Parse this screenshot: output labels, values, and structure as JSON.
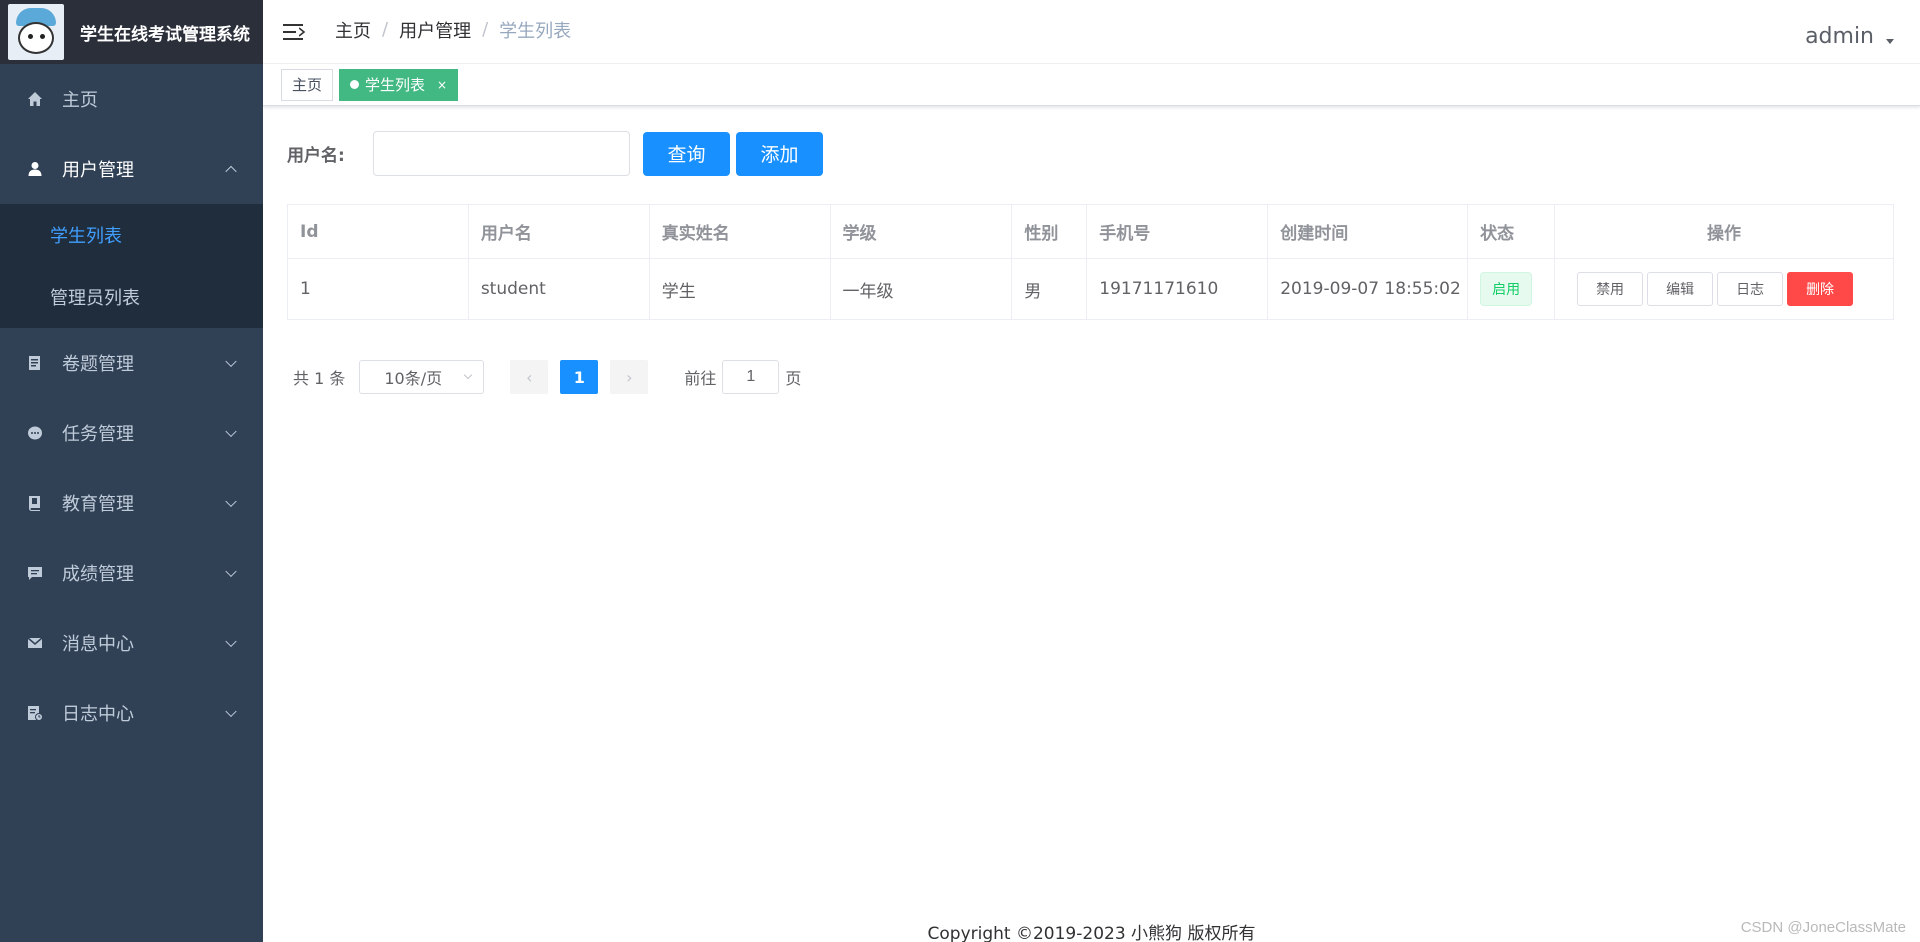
{
  "app": {
    "title": "学生在线考试管理系统",
    "user": "admin"
  },
  "sidebar": {
    "items": [
      {
        "label": "主页",
        "icon": "home-icon"
      },
      {
        "label": "用户管理",
        "icon": "user-icon",
        "expanded": true,
        "children": [
          {
            "label": "学生列表",
            "active": true
          },
          {
            "label": "管理员列表"
          }
        ]
      },
      {
        "label": "卷题管理",
        "icon": "paper-icon"
      },
      {
        "label": "任务管理",
        "icon": "task-icon"
      },
      {
        "label": "教育管理",
        "icon": "book-icon"
      },
      {
        "label": "成绩管理",
        "icon": "chat-icon"
      },
      {
        "label": "消息中心",
        "icon": "mail-icon"
      },
      {
        "label": "日志中心",
        "icon": "log-icon"
      }
    ]
  },
  "breadcrumb": [
    "主页",
    "用户管理",
    "学生列表"
  ],
  "breadcrumb_separator": "/",
  "tags": [
    {
      "label": "主页",
      "active": false
    },
    {
      "label": "学生列表",
      "active": true,
      "close": "×"
    }
  ],
  "search": {
    "label": "用户名:",
    "value": "",
    "placeholder": "",
    "query_label": "查询",
    "add_label": "添加"
  },
  "table": {
    "headers": [
      "Id",
      "用户名",
      "真实姓名",
      "学级",
      "性别",
      "手机号",
      "创建时间",
      "状态",
      "操作"
    ],
    "rows": [
      {
        "id": "1",
        "username": "student",
        "realname": "学生",
        "grade": "一年级",
        "sex": "男",
        "phone": "19171171610",
        "created": "2019-09-07 18:55:02",
        "status": "启用",
        "actions": [
          "禁用",
          "编辑",
          "日志",
          "删除"
        ]
      }
    ]
  },
  "pagination": {
    "total_text": "共 1 条",
    "page_size": "10条/页",
    "current_page": "1",
    "goto_prefix": "前往",
    "goto_value": "1",
    "goto_suffix": "页",
    "prev_symbol": "‹",
    "next_symbol": "›"
  },
  "footer": "Copyright ©2019-2023 小熊狗 版权所有",
  "watermark": "CSDN @JoneClassMate",
  "colors": {
    "sidebar_bg": "#304156",
    "logo_bg": "#2b2f3a",
    "submenu_bg": "#1f2d3d",
    "primary": "#1890ff",
    "active_tag": "#42b983",
    "danger": "#ff4949",
    "success": "#13ce66"
  }
}
